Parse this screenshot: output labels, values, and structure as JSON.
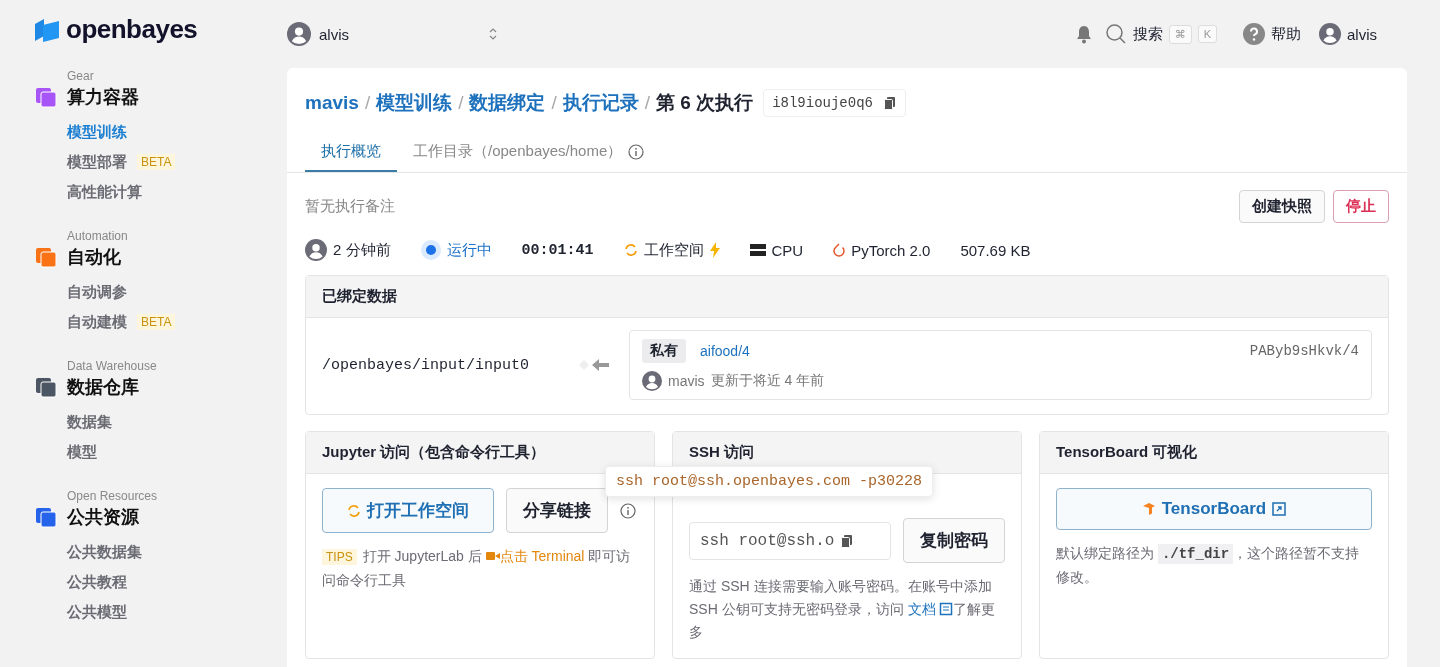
{
  "sidebar": {
    "logo": "openbayes",
    "groups": [
      {
        "section": "Gear",
        "title": "算力容器",
        "color": "#a855f7",
        "items": [
          {
            "label": "模型训练",
            "selected": true
          },
          {
            "label": "模型部署",
            "badge": "BETA",
            "selected": false
          },
          {
            "label": "高性能计算",
            "selected": false
          }
        ]
      },
      {
        "section": "Automation",
        "title": "自动化",
        "color": "#f97316",
        "items": [
          {
            "label": "自动调参",
            "selected": false
          },
          {
            "label": "自动建模",
            "badge": "BETA",
            "selected": false
          }
        ]
      },
      {
        "section": "Data Warehouse",
        "title": "数据仓库",
        "color": "#4b5563",
        "items": [
          {
            "label": "数据集",
            "selected": false
          },
          {
            "label": "模型",
            "selected": false
          }
        ]
      },
      {
        "section": "Open Resources",
        "title": "公共资源",
        "color": "#2563eb",
        "items": [
          {
            "label": "公共数据集",
            "selected": false
          },
          {
            "label": "公共教程",
            "selected": false
          },
          {
            "label": "公共模型",
            "selected": false
          }
        ]
      }
    ]
  },
  "topbar": {
    "user_selector": "alvis",
    "search": "搜索",
    "keys": [
      "⌘",
      "K"
    ],
    "help": "帮助",
    "user": "alvis"
  },
  "breadcrumb": {
    "links": [
      "mavis",
      "模型训练",
      "数据绑定",
      "执行记录"
    ],
    "separator": "/",
    "current": "第 6 次执行",
    "id": "i8l9iouje0q6"
  },
  "tabs": [
    {
      "label": "执行概览",
      "selected": true
    },
    {
      "label": "工作目录（/openbayes/home）",
      "selected": false
    }
  ],
  "note": "暂无执行备注",
  "actions": [
    {
      "label": "创建快照",
      "kind": "default"
    },
    {
      "label": "停止",
      "kind": "danger"
    }
  ],
  "status": {
    "created": "2 分钟前",
    "state": "运行中",
    "duration": "00:01:41",
    "workspace": "工作空间",
    "resource": "CPU",
    "framework": "PyTorch 2.0",
    "size": "507.69 KB"
  },
  "binding": {
    "title": "已绑定数据",
    "path": "/openbayes/input/input0",
    "tag": "私有",
    "dataset": "aifood/4",
    "version": "PAByb9sHkvk/4",
    "user": "mavis",
    "updated": "更新于将近 4 年前"
  },
  "jupyter": {
    "title": "Jupyter 访问（包含命令行工具）",
    "open": "打开工作空间",
    "share": "分享链接",
    "tips": "TIPS",
    "text_before": "打开 JupyterLab 后",
    "link": "点击 Terminal",
    "text_after": "即可访问命令行工具"
  },
  "ssh": {
    "title": "SSH 访问",
    "tooltip": "ssh root@ssh.openbayes.com -p30228",
    "command": "ssh root@ssh.o",
    "copy": "复制密码",
    "text": "通过 SSH 连接需要输入账号密码。在账号中添加 SSH 公钥可支持无密码登录，访问",
    "link": "文档",
    "text_after": "了解更多"
  },
  "tensorboard": {
    "title": "TensorBoard 可视化",
    "button": "TensorBoard",
    "text_before": "默认绑定路径为",
    "code": "./tf_dir",
    "text_after": "，这个路径暂不支持修改。"
  }
}
